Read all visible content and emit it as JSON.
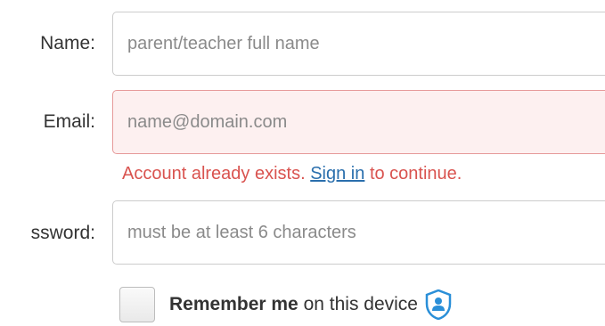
{
  "form": {
    "name": {
      "label": "Name:",
      "placeholder": "parent/teacher full name",
      "value": ""
    },
    "email": {
      "label": "Email:",
      "placeholder": "name@domain.com",
      "value": "",
      "state": "error",
      "error": {
        "prefix": "Account already exists.",
        "link_text": "Sign in",
        "suffix": "to continue."
      }
    },
    "password": {
      "label": "ssword:",
      "placeholder": "must be at least 6 characters",
      "value": ""
    },
    "remember": {
      "bold_text": "Remember me",
      "text": "on this device",
      "checked": false,
      "icon": "shield-user-icon"
    }
  },
  "colors": {
    "error_text": "#d9534f",
    "error_field_bg": "#fdf0f0",
    "error_field_border": "#e69a9a",
    "link": "#2a6fad",
    "shield": "#2a8fd8"
  }
}
